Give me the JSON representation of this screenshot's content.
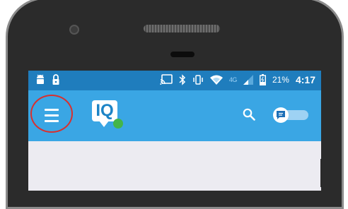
{
  "status_bar": {
    "left_icons": [
      "android-icon",
      "lock-icon"
    ],
    "right_icons": [
      "cast-icon",
      "bluetooth-icon",
      "vibrate-icon",
      "wifi-icon",
      "cell-signal-icon",
      "battery-icon"
    ],
    "network_label": "4G",
    "battery_percent": "21%",
    "time": "4:17"
  },
  "app_bar": {
    "logo_text": "IQ",
    "background_color": "#3aa6e4",
    "status_dot_color": "#43b549",
    "menu_icon": "hamburger-menu-icon",
    "search_icon": "search-icon",
    "chat_icon": "chat-bubble-icon",
    "highlight_color": "#d8302f"
  }
}
